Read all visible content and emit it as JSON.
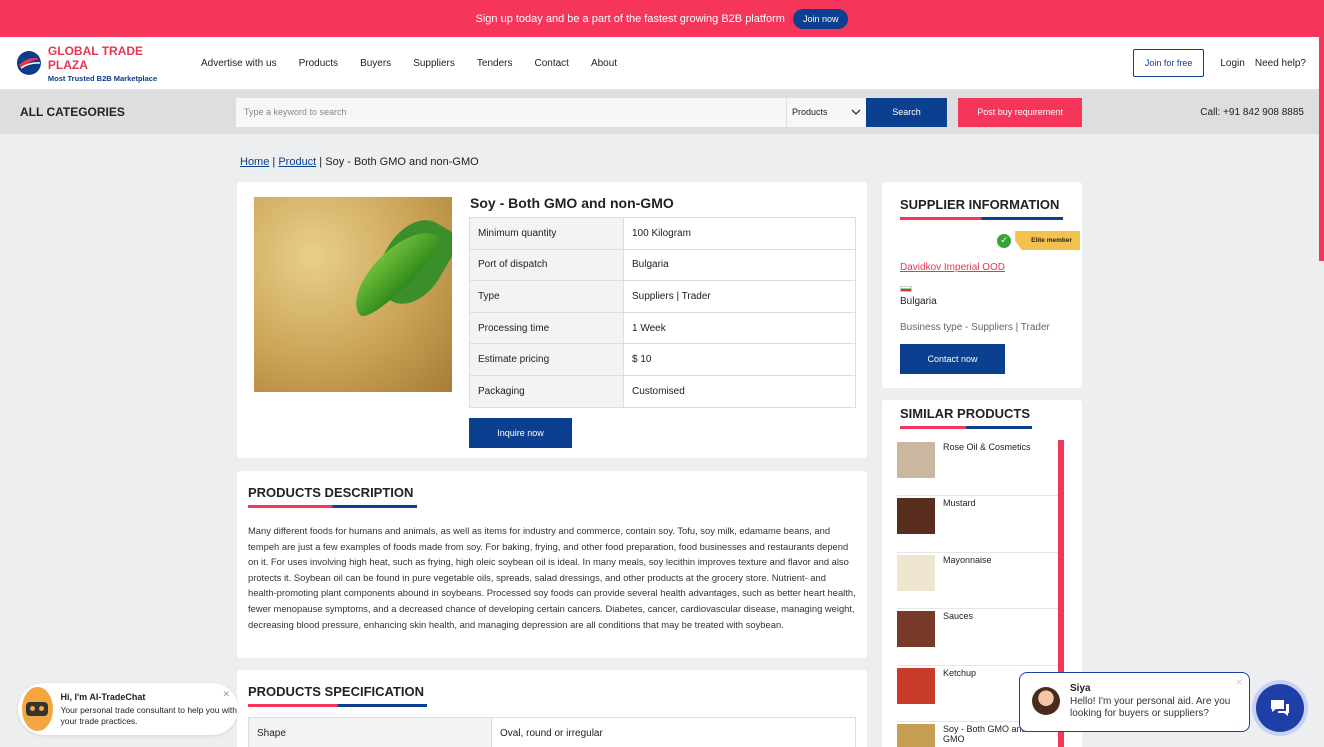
{
  "topbar": {
    "message": "Sign up today and be a part of the fastest growing B2B platform",
    "join_label": "Join now"
  },
  "logo": {
    "name_a": "GLOBAL",
    "name_b": "TRADE PLAZA",
    "tagline": "Most Trusted B2B Marketplace"
  },
  "nav": {
    "items": [
      "Advertise with us",
      "Products",
      "Buyers",
      "Suppliers",
      "Tenders",
      "Contact",
      "About"
    ],
    "join_free": "Join for free",
    "login": "Login",
    "help": "Need help?"
  },
  "search": {
    "all_categories": "ALL CATEGORIES",
    "placeholder": "Type a keyword to search",
    "scope": "Products",
    "button": "Search",
    "post": "Post buy requirement",
    "call": "Call: +91 842 908 8885"
  },
  "breadcrumb": {
    "home": "Home",
    "product": "Product",
    "current": "Soy - Both GMO and non-GMO"
  },
  "product": {
    "title": "Soy - Both GMO and non-GMO",
    "specs": [
      [
        "Minimum quantity",
        "100 Kilogram"
      ],
      [
        "Port of dispatch",
        "Bulgaria"
      ],
      [
        "Type",
        "Suppliers | Trader"
      ],
      [
        "Processing time",
        "1 Week"
      ],
      [
        "Estimate pricing",
        "$ 10"
      ],
      [
        "Packaging",
        "Customised"
      ]
    ],
    "inquire": "Inquire now"
  },
  "description": {
    "heading": "PRODUCTS DESCRIPTION",
    "text": "Many different foods for humans and animals, as well as items for industry and commerce, contain soy. Tofu, soy milk, edamame beans, and tempeh are just a few examples of foods made from soy. For baking, frying, and other food preparation, food businesses and restaurants depend on it. For uses involving high heat, such as frying, high oleic soybean oil is ideal. In many meals, soy lecithin improves texture and flavor and also protects it. Soybean oil can be found in pure vegetable oils, spreads, salad dressings, and other products at the grocery store. Nutrient- and health-promoting plant components abound in soybeans. Processed soy foods can provide several health advantages, such as better heart health, fewer menopause symptoms, and a decreased chance of developing certain cancers. Diabetes, cancer, cardiovascular disease, managing weight, decreasing blood pressure, enhancing skin health, and managing depression are all conditions that may be treated with soybean."
  },
  "specification": {
    "heading": "PRODUCTS SPECIFICATION",
    "row_label": "Shape",
    "row_value": "Oval, round or irregular"
  },
  "supplier": {
    "heading": "SUPPLIER INFORMATION",
    "badge": "Elite member",
    "name": "Davidkov Imperial OOD",
    "country": "Bulgaria",
    "business_type": "Business type - Suppliers | Trader",
    "contact": "Contact now"
  },
  "similar": {
    "heading": "SIMILAR PRODUCTS",
    "items": [
      {
        "name": "Rose Oil & Cosmetics",
        "color": "#c9b7a0"
      },
      {
        "name": "Mustard",
        "color": "#5a2e1e"
      },
      {
        "name": "Mayonnaise",
        "color": "#efe6cf"
      },
      {
        "name": "Sauces",
        "color": "#7a3a2a"
      },
      {
        "name": "Ketchup",
        "color": "#c83a2a"
      },
      {
        "name": "Soy - Both GMO and non-GMO",
        "color": "#c79f52"
      }
    ]
  },
  "chat_ai": {
    "title": "Hi, I'm AI-TradeChat",
    "body": "Your personal trade consultant to help you with your trade practices."
  },
  "chat_siya": {
    "name": "Siya",
    "message": "Hello! I'm your personal aid. Are you looking for buyers or suppliers?"
  },
  "colors": {
    "brand_blue": "#0b3f8f",
    "brand_red": "#f5355a"
  }
}
